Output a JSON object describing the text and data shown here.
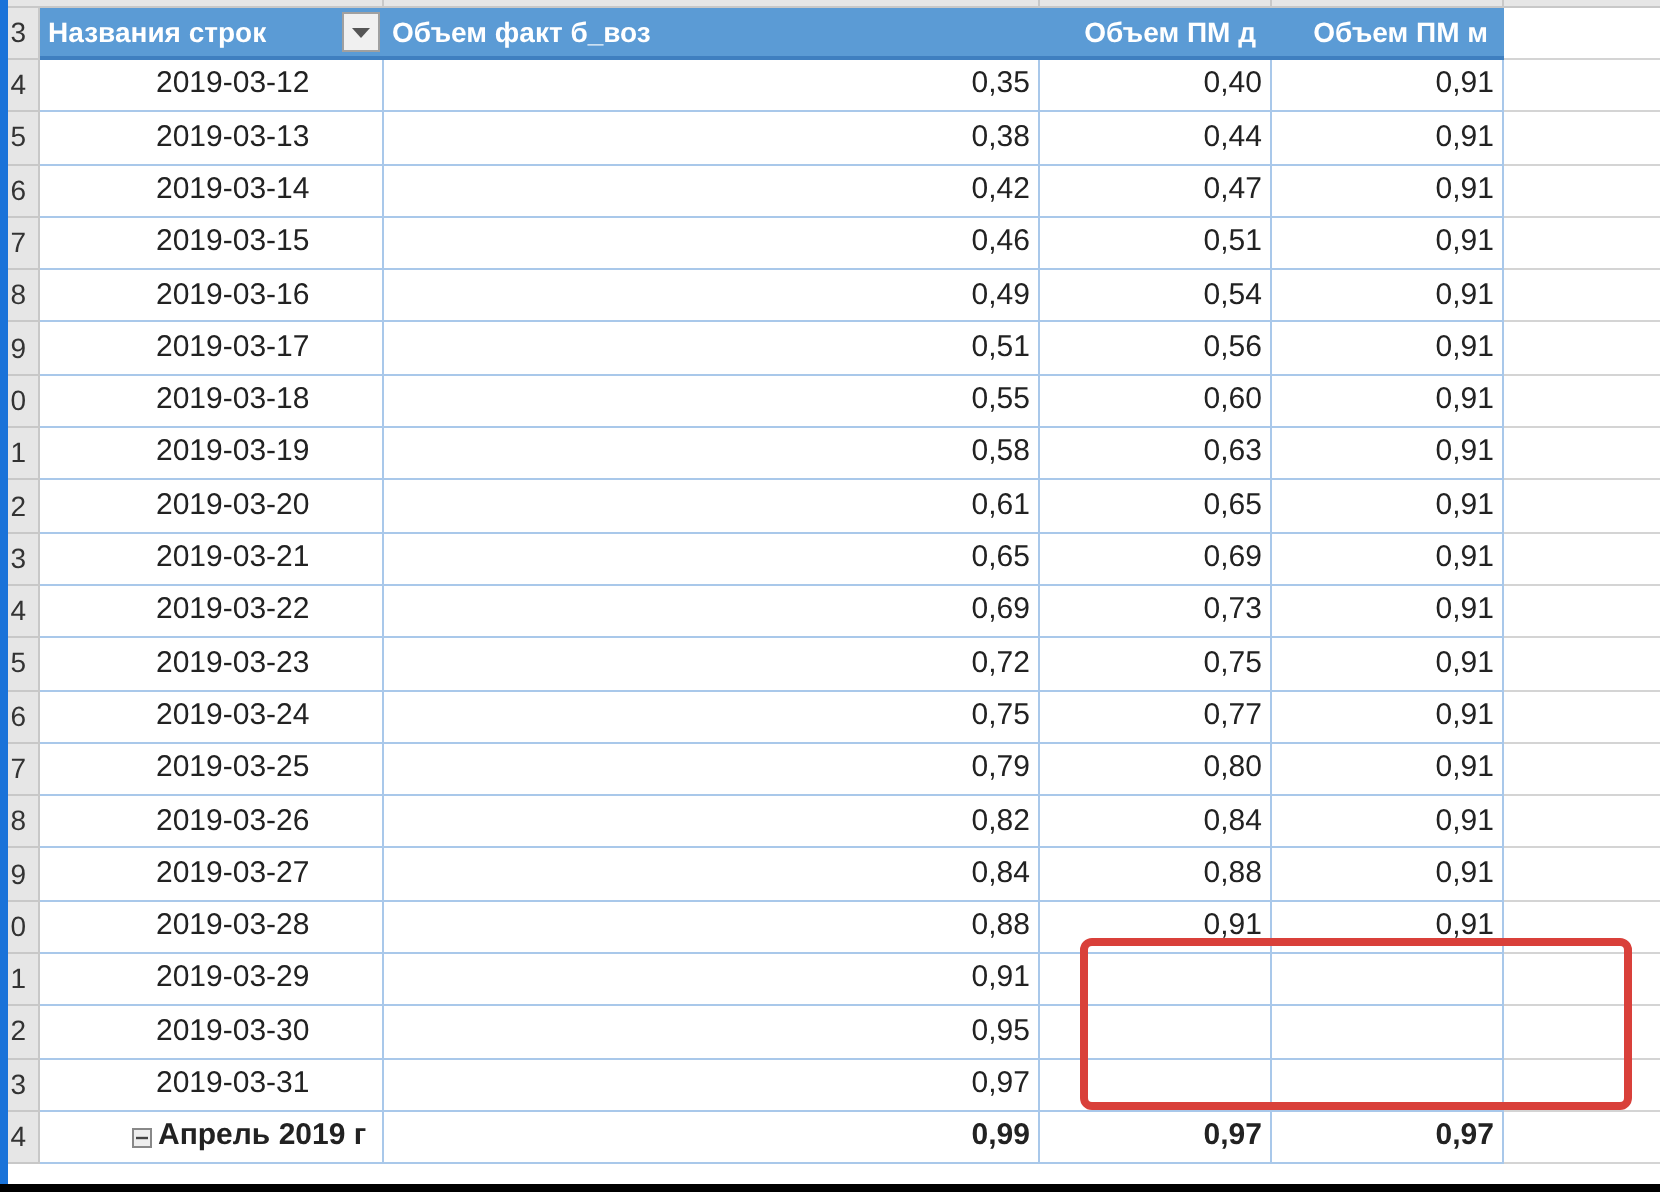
{
  "header": {
    "row_number": "3",
    "columns": [
      "Названия строк",
      "Объем факт б_воз",
      "Объем ПМ д",
      "Объем ПМ м"
    ]
  },
  "rows": [
    {
      "row_number": "4",
      "kind": "day",
      "cells": [
        "2019-03-12",
        "0,35",
        "0,40",
        "0,91"
      ]
    },
    {
      "row_number": "5",
      "kind": "day",
      "cells": [
        "2019-03-13",
        "0,38",
        "0,44",
        "0,91"
      ]
    },
    {
      "row_number": "6",
      "kind": "day",
      "cells": [
        "2019-03-14",
        "0,42",
        "0,47",
        "0,91"
      ]
    },
    {
      "row_number": "7",
      "kind": "day",
      "cells": [
        "2019-03-15",
        "0,46",
        "0,51",
        "0,91"
      ]
    },
    {
      "row_number": "8",
      "kind": "day",
      "cells": [
        "2019-03-16",
        "0,49",
        "0,54",
        "0,91"
      ]
    },
    {
      "row_number": "9",
      "kind": "day",
      "cells": [
        "2019-03-17",
        "0,51",
        "0,56",
        "0,91"
      ]
    },
    {
      "row_number": "0",
      "kind": "day",
      "cells": [
        "2019-03-18",
        "0,55",
        "0,60",
        "0,91"
      ]
    },
    {
      "row_number": "1",
      "kind": "day",
      "cells": [
        "2019-03-19",
        "0,58",
        "0,63",
        "0,91"
      ]
    },
    {
      "row_number": "2",
      "kind": "day",
      "cells": [
        "2019-03-20",
        "0,61",
        "0,65",
        "0,91"
      ]
    },
    {
      "row_number": "3",
      "kind": "day",
      "cells": [
        "2019-03-21",
        "0,65",
        "0,69",
        "0,91"
      ]
    },
    {
      "row_number": "4",
      "kind": "day",
      "cells": [
        "2019-03-22",
        "0,69",
        "0,73",
        "0,91"
      ]
    },
    {
      "row_number": "5",
      "kind": "day",
      "cells": [
        "2019-03-23",
        "0,72",
        "0,75",
        "0,91"
      ]
    },
    {
      "row_number": "6",
      "kind": "day",
      "cells": [
        "2019-03-24",
        "0,75",
        "0,77",
        "0,91"
      ]
    },
    {
      "row_number": "7",
      "kind": "day",
      "cells": [
        "2019-03-25",
        "0,79",
        "0,80",
        "0,91"
      ]
    },
    {
      "row_number": "8",
      "kind": "day",
      "cells": [
        "2019-03-26",
        "0,82",
        "0,84",
        "0,91"
      ]
    },
    {
      "row_number": "9",
      "kind": "day",
      "cells": [
        "2019-03-27",
        "0,84",
        "0,88",
        "0,91"
      ]
    },
    {
      "row_number": "0",
      "kind": "day",
      "cells": [
        "2019-03-28",
        "0,88",
        "0,91",
        "0,91"
      ]
    },
    {
      "row_number": "1",
      "kind": "day",
      "cells": [
        "2019-03-29",
        "0,91",
        "",
        ""
      ]
    },
    {
      "row_number": "2",
      "kind": "day",
      "cells": [
        "2019-03-30",
        "0,95",
        "",
        ""
      ]
    },
    {
      "row_number": "3",
      "kind": "day",
      "cells": [
        "2019-03-31",
        "0,97",
        "",
        ""
      ]
    },
    {
      "row_number": "4",
      "kind": "month",
      "expanded": true,
      "cells": [
        "Апрель 2019 г",
        "0,99",
        "0,97",
        "0,97"
      ]
    }
  ]
}
